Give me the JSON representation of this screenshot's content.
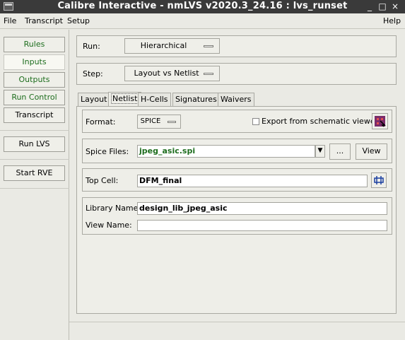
{
  "window": {
    "title": "Calibre Interactive - nmLVS v2020.3_24.16 : lvs_runset"
  },
  "menubar": {
    "file": "File",
    "transcript": "Transcript",
    "setup": "Setup",
    "help": "Help"
  },
  "nav": {
    "rules": "Rules",
    "inputs": "Inputs",
    "outputs": "Outputs",
    "run_control": "Run Control",
    "transcript": "Transcript",
    "run_lvs": "Run LVS",
    "start_rve": "Start RVE"
  },
  "run": {
    "label": "Run:",
    "value": "Hierarchical"
  },
  "step": {
    "label": "Step:",
    "value": "Layout vs Netlist"
  },
  "tabs": [
    "Layout",
    "Netlist",
    "H-Cells",
    "Signatures",
    "Waivers"
  ],
  "netlist": {
    "format_label": "Format:",
    "format_value": "SPICE",
    "export_label": "Export from schematic viewer",
    "spice_label": "Spice Files:",
    "spice_value": "jpeg_asic.spi",
    "browse_label": "...",
    "view_label": "View",
    "topcell_label": "Top Cell:",
    "topcell_value": "DFM_final",
    "library_label": "Library Name:",
    "library_value": "design_lib_jpeg_asic",
    "viewname_label": "View Name:",
    "viewname_value": ""
  },
  "colors": {
    "titlebar": "#3a3a3a",
    "nav_green": "#1d6d1d",
    "spice_green": "#1d6d1d"
  }
}
